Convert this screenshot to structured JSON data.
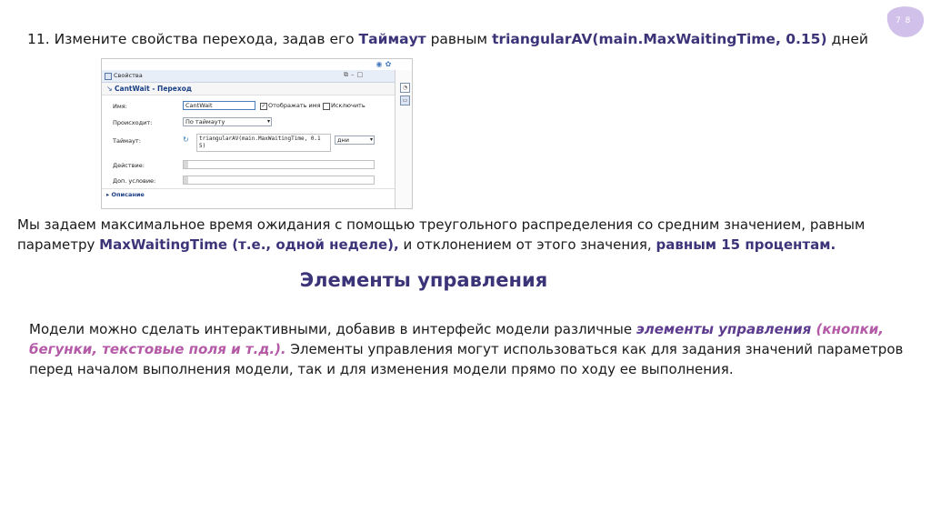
{
  "slide": {
    "page_number": "7 8",
    "line1": {
      "prefix": "11. Измените свойства перехода, задав его ",
      "timeout_word": "Таймаут",
      "middle": " равным ",
      "expression": "triangularAV(main.MaxWaitingTime, 0.15)",
      "suffix": " дней"
    },
    "para1": {
      "p1": "Мы задаем максимальное время ожидания с помощью треугольного распределения со средним значением, равным параметру ",
      "param": "MaxWaitingTime (т.е., одной неделе),",
      "p2": " и отклонением от этого значения, ",
      "percent": "равным 15 процентам."
    },
    "heading": "Элементы управления",
    "para2": {
      "p1": "Модели можно сделать интерактивными, добавив в интерфейс модели различные ",
      "term": "элементы управления",
      "paren_open": " (",
      "examples": "кнопки, бегунки, текстовые поля и т.д.).",
      "p2": " Элементы управления могут использоваться как для задания значений параметров перед началом выполнения модели, так и для изменения модели прямо по ходу ее выполнения."
    }
  },
  "panel": {
    "tab_title": "Свойства",
    "header": "CantWait - Переход",
    "name_label": "Имя:",
    "name_value": "CantWait",
    "show_name_label": "Отображать имя",
    "show_name_checked": true,
    "exclude_label": "Исключить",
    "exclude_checked": false,
    "occurs_label": "Происходит:",
    "occurs_value": "По таймауту",
    "timeout_label": "Таймаут:",
    "timeout_expr_line1": "triangularAV(main.MaxWaitingTime, 0.1",
    "timeout_expr_line2": "5)",
    "timeout_unit": "дни",
    "action_label": "Действие:",
    "condition_label": "Доп. условие:",
    "description_label": "Описание"
  }
}
